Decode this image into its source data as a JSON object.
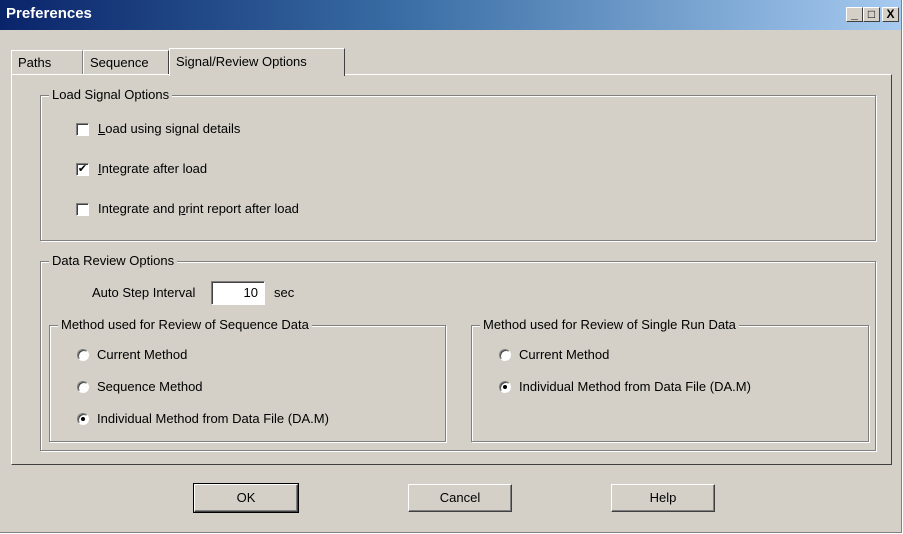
{
  "window": {
    "title": "Preferences"
  },
  "titlebar_buttons": {
    "minimize": "_",
    "maximize": "□",
    "close": "X"
  },
  "tabs": [
    {
      "label": "Paths",
      "active": false
    },
    {
      "label": "Sequence",
      "active": false
    },
    {
      "label": "Signal/Review Options",
      "active": true
    }
  ],
  "load_signal": {
    "legend": "Load Signal Options",
    "options": [
      {
        "mnemonic": "L",
        "rest": "oad using signal details",
        "checked": false
      },
      {
        "mnemonic": "I",
        "rest": "ntegrate after load",
        "checked": true
      },
      {
        "pre": "Integrate and ",
        "mnemonic": "p",
        "rest": "rint report after load",
        "checked": false
      }
    ]
  },
  "data_review": {
    "legend": "Data Review Options",
    "auto_step_label": "Auto Step Interval",
    "auto_step_value": "10",
    "auto_step_unit": "sec",
    "sequence_group": {
      "legend": "Method used for Review of Sequence Data",
      "options": [
        {
          "label": "Current Method",
          "selected": false
        },
        {
          "label": "Sequence Method",
          "selected": false
        },
        {
          "label": "Individual Method from Data File (DA.M)",
          "selected": true
        }
      ]
    },
    "single_run_group": {
      "legend": "Method used for Review of Single Run Data",
      "options": [
        {
          "label": "Current Method",
          "selected": false
        },
        {
          "label": "Individual Method from Data File (DA.M)",
          "selected": true
        }
      ]
    }
  },
  "buttons": {
    "ok": "OK",
    "cancel": "Cancel",
    "help": "Help"
  },
  "colors": {
    "face": "#d4d0c8",
    "title_start": "#0a246a",
    "title_end": "#a6caf0"
  }
}
